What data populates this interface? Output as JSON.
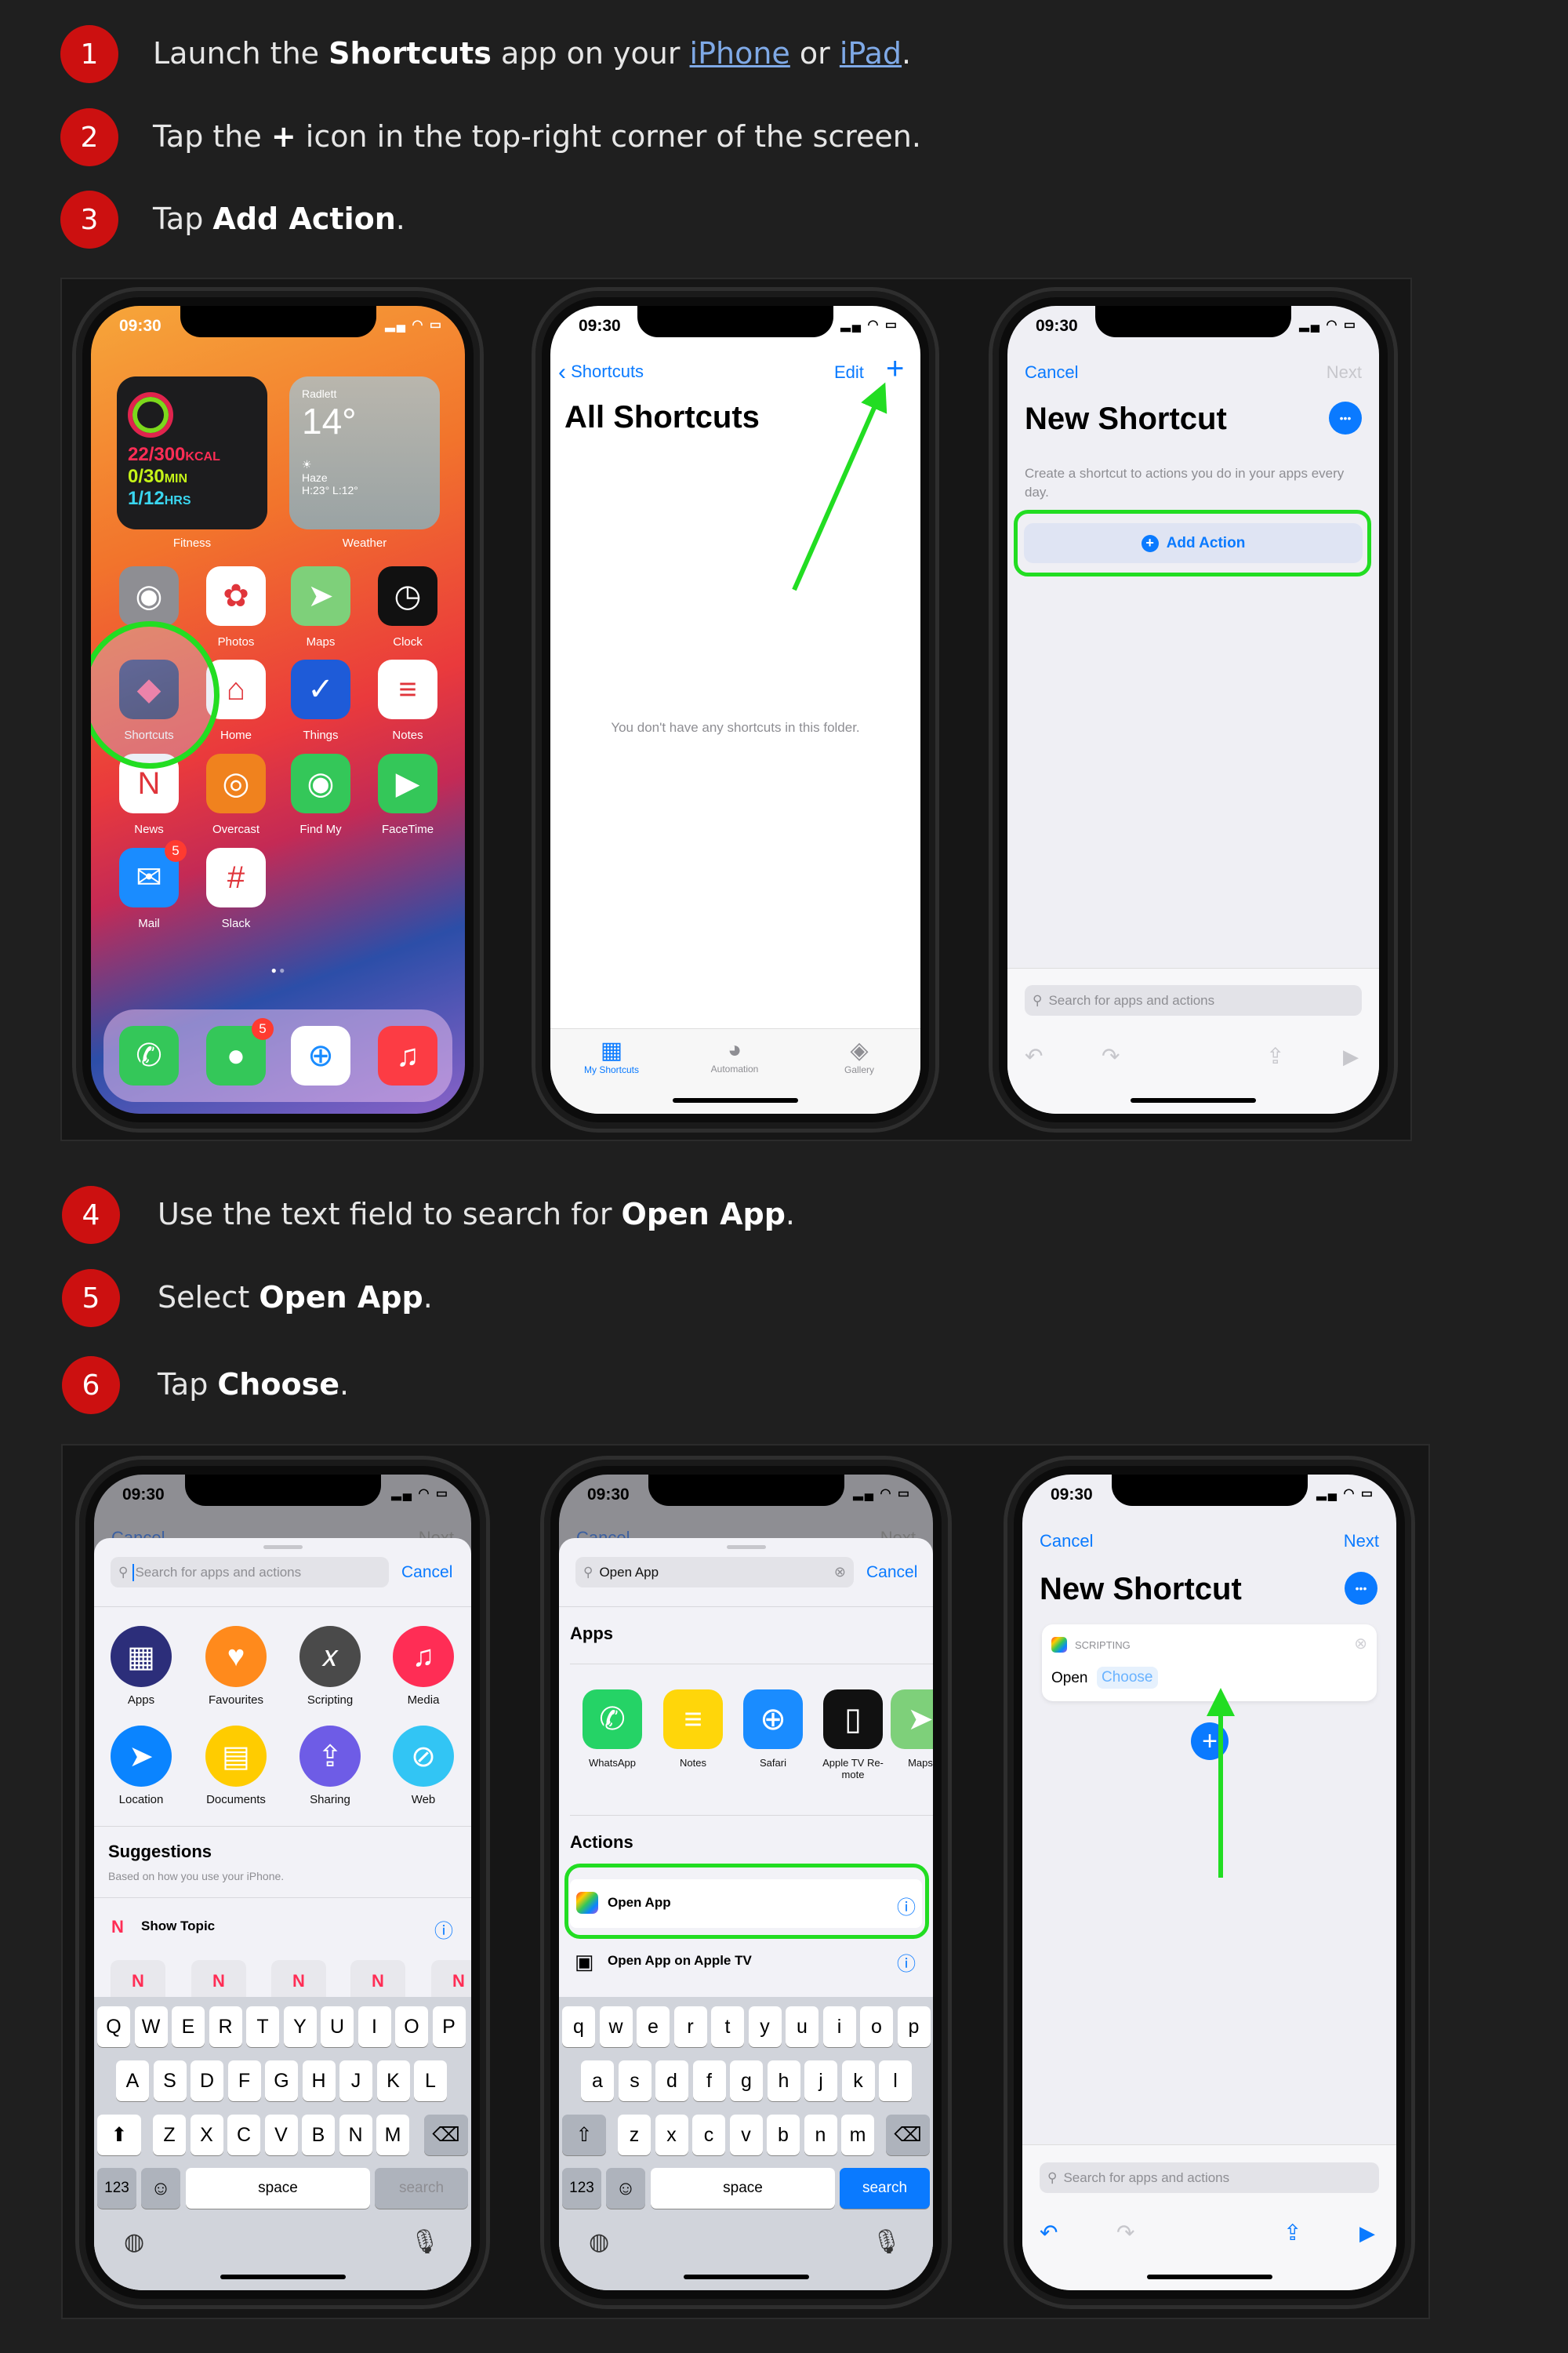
{
  "steps": [
    {
      "number": "1",
      "segments": [
        {
          "text": "Launch the "
        },
        {
          "text": "Shortcuts",
          "bold": true
        },
        {
          "text": " app on your "
        },
        {
          "text": "iPhone",
          "link": true
        },
        {
          "text": " or "
        },
        {
          "text": "iPad",
          "link": true
        },
        {
          "text": "."
        }
      ]
    },
    {
      "number": "2",
      "segments": [
        {
          "text": "Tap the "
        },
        {
          "text": "+",
          "bold": true
        },
        {
          "text": " icon in the top-right corner of the screen."
        }
      ]
    },
    {
      "number": "3",
      "segments": [
        {
          "text": "Tap "
        },
        {
          "text": "Add Action",
          "bold": true
        },
        {
          "text": "."
        }
      ]
    },
    {
      "number": "4",
      "segments": [
        {
          "text": "Use the text field to search for "
        },
        {
          "text": "Open App",
          "bold": true
        },
        {
          "text": "."
        }
      ]
    },
    {
      "number": "5",
      "segments": [
        {
          "text": "Select "
        },
        {
          "text": "Open App",
          "bold": true
        },
        {
          "text": "."
        }
      ]
    },
    {
      "number": "6",
      "segments": [
        {
          "text": "Tap "
        },
        {
          "text": "Choose",
          "bold": true
        },
        {
          "text": "."
        }
      ]
    }
  ],
  "colors": {
    "step_badge": "#cc1010",
    "highlight": "#22dd22",
    "ios_blue": "#0a7aff",
    "link": "#7fa9e6"
  },
  "status_time": "09:30",
  "home_screen": {
    "fitness": {
      "kcal": "22/300",
      "kcal_unit": "KCAL",
      "min": "0/30",
      "min_unit": "MIN",
      "hrs": "1/12",
      "hrs_unit": "HRS",
      "label": "Fitness"
    },
    "weather": {
      "location": "Radlett",
      "temp": "14°",
      "condition": "Haze",
      "range": "H:23° L:12°",
      "label": "Weather"
    },
    "apps": [
      {
        "label": "",
        "icon": "camera-icon",
        "glyph": "◉",
        "color": "#8e8e93"
      },
      {
        "label": "Photos",
        "icon": "photos-icon",
        "glyph": "✿",
        "color": "#ffffff"
      },
      {
        "label": "Maps",
        "icon": "maps-icon",
        "glyph": "➤",
        "color": "#7ed07a"
      },
      {
        "label": "Clock",
        "icon": "clock-icon",
        "glyph": "◷",
        "color": "#111111"
      },
      {
        "label": "Shortcuts",
        "icon": "shortcuts-icon",
        "glyph": "◆",
        "color": "#2a2f6e"
      },
      {
        "label": "Home",
        "icon": "home-icon",
        "glyph": "⌂",
        "color": "#ffffff"
      },
      {
        "label": "Things",
        "icon": "things-icon",
        "glyph": "✓",
        "color": "#1e5bd8"
      },
      {
        "label": "Notes",
        "icon": "notes-icon",
        "glyph": "≡",
        "color": "#ffffff"
      },
      {
        "label": "News",
        "icon": "news-icon",
        "glyph": "N",
        "color": "#ffffff"
      },
      {
        "label": "Overcast",
        "icon": "overcast-icon",
        "glyph": "◎",
        "color": "#f0821e"
      },
      {
        "label": "Find My",
        "icon": "find-my-icon",
        "glyph": "◉",
        "color": "#34c759"
      },
      {
        "label": "FaceTime",
        "icon": "facetime-icon",
        "glyph": "▶",
        "color": "#34c759"
      },
      {
        "label": "Mail",
        "icon": "mail-icon",
        "glyph": "✉",
        "color": "#1a8cff",
        "badge": "5"
      },
      {
        "label": "Slack",
        "icon": "slack-icon",
        "glyph": "#",
        "color": "#ffffff"
      }
    ],
    "dock": [
      {
        "icon": "phone-icon",
        "glyph": "✆",
        "color": "#34c759"
      },
      {
        "icon": "messages-icon",
        "glyph": "●",
        "color": "#34c759",
        "badge": "5"
      },
      {
        "icon": "safari-icon",
        "glyph": "⊕",
        "color": "#ffffff"
      },
      {
        "icon": "music-icon",
        "glyph": "♫",
        "color": "#fc3c44"
      }
    ]
  },
  "all_shortcuts": {
    "back": "Shortcuts",
    "edit": "Edit",
    "add": "+",
    "title": "All Shortcuts",
    "empty": "You don't have any shortcuts in this folder.",
    "tabs": [
      {
        "label": "My Shortcuts",
        "icon": "grid-icon",
        "glyph": "▦",
        "active": true
      },
      {
        "label": "Automation",
        "icon": "automation-icon",
        "glyph": "◕"
      },
      {
        "label": "Gallery",
        "icon": "gallery-icon",
        "glyph": "◈"
      }
    ]
  },
  "new_shortcut": {
    "cancel": "Cancel",
    "next": "Next",
    "title": "New Shortcut",
    "more": "•••",
    "description": "Create a shortcut to actions you do in your apps every day.",
    "add_action": "Add Action",
    "search_placeholder": "Search for apps and actions"
  },
  "search_sheet": {
    "placeholder": "Search for apps and actions",
    "cancel": "Cancel",
    "bg_cancel": "Cancel",
    "bg_next": "Next",
    "categories": [
      {
        "label": "Apps",
        "glyph": "▦",
        "color": "#2c2e7a"
      },
      {
        "label": "Favourites",
        "glyph": "♥",
        "color": "#ff8a1c"
      },
      {
        "label": "Scripting",
        "glyph": "𝑥",
        "color": "#4a4a4a"
      },
      {
        "label": "Media",
        "glyph": "♫",
        "color": "#ff2d55"
      },
      {
        "label": "Location",
        "glyph": "➤",
        "color": "#0a84ff"
      },
      {
        "label": "Documents",
        "glyph": "▤",
        "color": "#ffcc00"
      },
      {
        "label": "Sharing",
        "glyph": "⇪",
        "color": "#6e5ce6"
      },
      {
        "label": "Web",
        "glyph": "⊘",
        "color": "#32c5f4"
      }
    ],
    "suggestions_title": "Suggestions",
    "suggestions_sub": "Based on how you use your iPhone.",
    "suggestion": "Show Topic"
  },
  "search_results": {
    "query": "Open App",
    "cancel": "Cancel",
    "apps_heading": "Apps",
    "apps": [
      {
        "label": "WhatsApp",
        "glyph": "✆",
        "color": "#25d366"
      },
      {
        "label": "Notes",
        "glyph": "≡",
        "color": "#ffd60a"
      },
      {
        "label": "Safari",
        "glyph": "⊕",
        "color": "#1a8cff"
      },
      {
        "label": "Apple TV Re-mote",
        "glyph": "▯",
        "color": "#111111"
      },
      {
        "label": "Maps",
        "glyph": "➤",
        "color": "#7ed07a"
      }
    ],
    "actions_heading": "Actions",
    "actions": [
      "Open App",
      "Open App on Apple TV"
    ]
  },
  "open_action": {
    "category": "SCRIPTING",
    "verb": "Open",
    "choose": "Choose"
  },
  "keyboard": {
    "row1": [
      "Q",
      "W",
      "E",
      "R",
      "T",
      "Y",
      "U",
      "I",
      "O",
      "P"
    ],
    "row2": [
      "A",
      "S",
      "D",
      "F",
      "G",
      "H",
      "J",
      "K",
      "L"
    ],
    "row3": [
      "Z",
      "X",
      "C",
      "V",
      "B",
      "N",
      "M"
    ],
    "numbers": "123",
    "space": "space",
    "search": "search"
  }
}
